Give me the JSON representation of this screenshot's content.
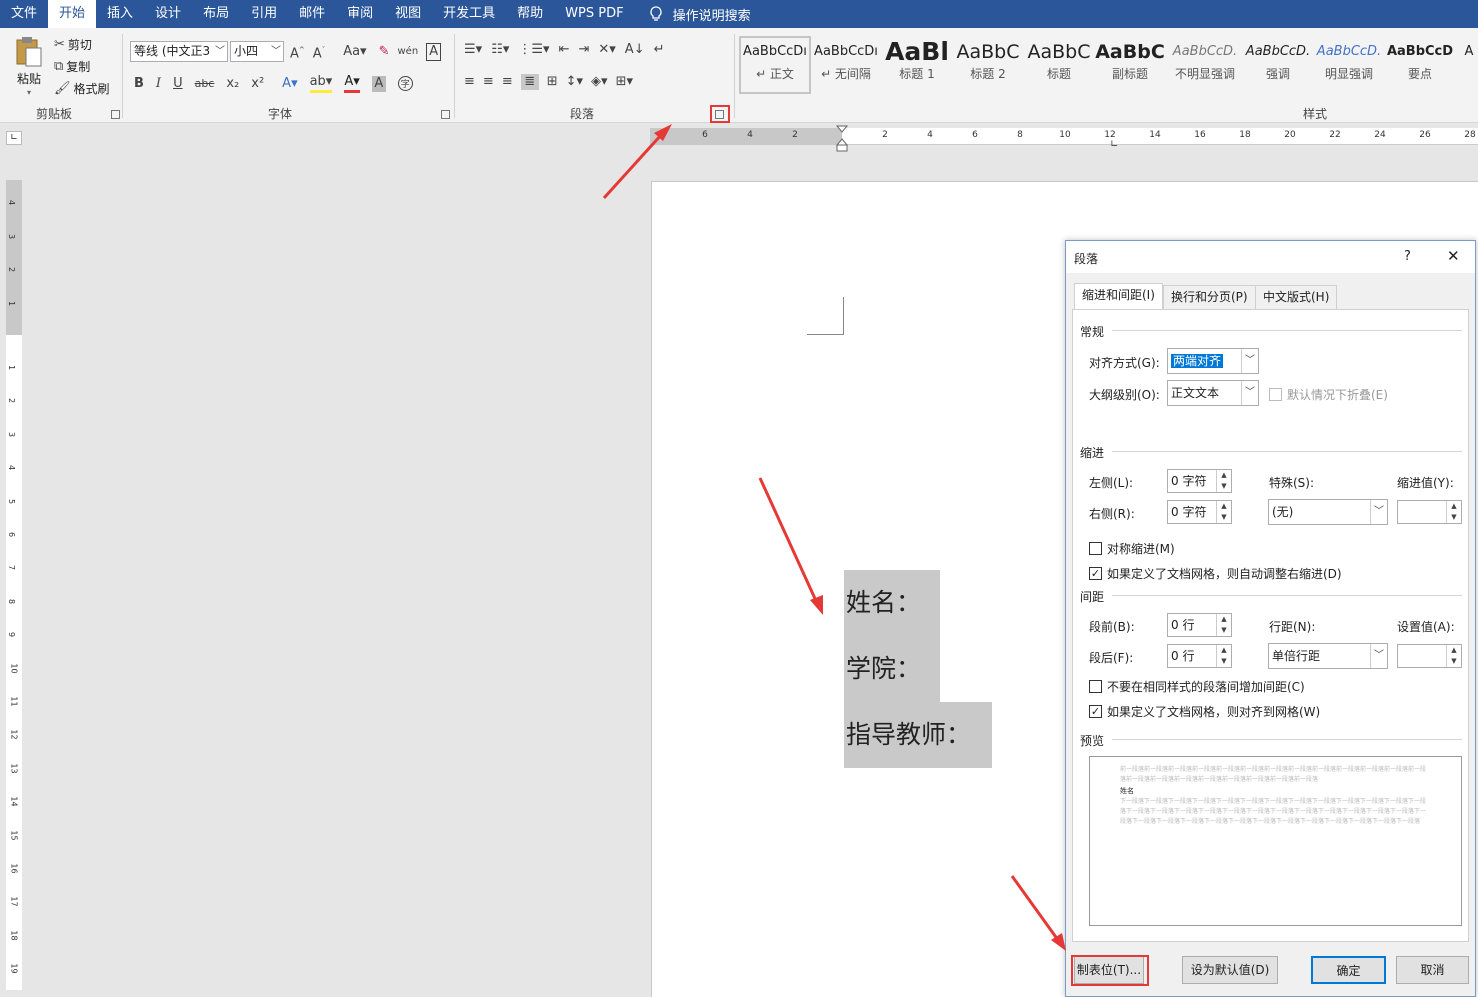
{
  "menubar": {
    "tabs": [
      "文件",
      "开始",
      "插入",
      "设计",
      "布局",
      "引用",
      "邮件",
      "审阅",
      "视图",
      "开发工具",
      "帮助",
      "WPS PDF"
    ],
    "active_index": 1,
    "tell_me": "操作说明搜索",
    "bg_color": "#2b579a"
  },
  "clipboard": {
    "paste": "粘贴",
    "cut": "剪切",
    "copy": "复制",
    "format_painter": "格式刷",
    "group_label": "剪贴板"
  },
  "font": {
    "font_name": "等线 (中文正3",
    "font_size": "小四",
    "group_label": "字体",
    "buttons": [
      "B",
      "I",
      "U",
      "abc",
      "x₂",
      "x²"
    ]
  },
  "paragraph": {
    "group_label": "段落"
  },
  "styles": {
    "group_label": "样式",
    "items": [
      {
        "sample": "AaBbCcDı",
        "name": "↵ 正文"
      },
      {
        "sample": "AaBbCcDı",
        "name": "↵ 无间隔"
      },
      {
        "sample": "AaBl",
        "name": "标题 1"
      },
      {
        "sample": "AaBbC",
        "name": "标题 2"
      },
      {
        "sample": "AaBbC",
        "name": "标题"
      },
      {
        "sample": "AaBbC",
        "name": "副标题"
      },
      {
        "sample": "AaBbCcD.",
        "name": "不明显强调"
      },
      {
        "sample": "AaBbCcD.",
        "name": "强调"
      },
      {
        "sample": "AaBbCcD.",
        "name": "明显强调"
      },
      {
        "sample": "AaBbCcD",
        "name": "要点"
      },
      {
        "sample": "A"
      }
    ]
  },
  "ruler": {
    "h_marks_left": [
      "8",
      "6",
      "4",
      "2"
    ],
    "h_marks_right": [
      "2",
      "4",
      "6",
      "8",
      "10",
      "12",
      "14",
      "16",
      "18",
      "20",
      "22",
      "24",
      "26",
      "28"
    ],
    "v_marks_top": [
      "4",
      "3",
      "2",
      "1"
    ],
    "v_marks": [
      "1",
      "2",
      "3",
      "4",
      "5",
      "6",
      "7",
      "8",
      "9",
      "10",
      "11",
      "12",
      "13",
      "14",
      "15",
      "16",
      "17",
      "18",
      "19"
    ]
  },
  "document": {
    "lines": [
      "姓名：",
      "学院：",
      "指导教师："
    ]
  },
  "dialog": {
    "title": "段落",
    "help": "?",
    "close": "✕",
    "tabs": [
      "缩进和间距(I)",
      "换行和分页(P)",
      "中文版式(H)"
    ],
    "general": {
      "section": "常规",
      "alignment_label": "对齐方式(G):",
      "alignment_value": "两端对齐",
      "outline_label": "大纲级别(O):",
      "outline_value": "正文文本",
      "collapse_label": "默认情况下折叠(E)"
    },
    "indent": {
      "section": "缩进",
      "left_label": "左侧(L):",
      "left_value": "0 字符",
      "right_label": "右侧(R):",
      "right_value": "0 字符",
      "special_label": "特殊(S):",
      "special_value": "(无)",
      "by_label": "缩进值(Y):",
      "mirror_label": "对称缩进(M)",
      "auto_adjust_label": "如果定义了文档网格，则自动调整右缩进(D)"
    },
    "spacing": {
      "section": "间距",
      "before_label": "段前(B):",
      "before_value": "0 行",
      "after_label": "段后(F):",
      "after_value": "0 行",
      "line_label": "行距(N):",
      "line_value": "单倍行距",
      "at_label": "设置值(A):",
      "no_space_label": "不要在相同样式的段落间增加间距(C)",
      "snap_grid_label": "如果定义了文档网格，则对齐到网格(W)"
    },
    "preview": {
      "section": "预览",
      "prev_text": "前一段落前一段落前一段落前一段落前一段落前一段落前一段落前一段落前一段落前一段落前一段落前一段落前一段落前一段落前一段落前一段落前一段落前一段落前一段落前一段落前一段落",
      "sample": "姓名",
      "next_text": "下一段落下一段落下一段落下一段落下一段落下一段落下一段落下一段落下一段落下一段落下一段落下一段落下一段落下一段落下一段落下一段落下一段落下一段落下一段落下一段落下一段落下一段落下一段落下一段落下一段落下一段落下一段落下一段落下一段落下一段落下一段落下一段落下一段落下一段落下一段落下一段落下一段落下一段落"
    },
    "buttons": {
      "tabs": "制表位(T)...",
      "default": "设为默认值(D)",
      "ok": "确定",
      "cancel": "取消"
    }
  },
  "colors": {
    "annotation": "#e53935",
    "selection_highlight": "#c9c9c9",
    "dialog_selected": "#0078d7"
  }
}
